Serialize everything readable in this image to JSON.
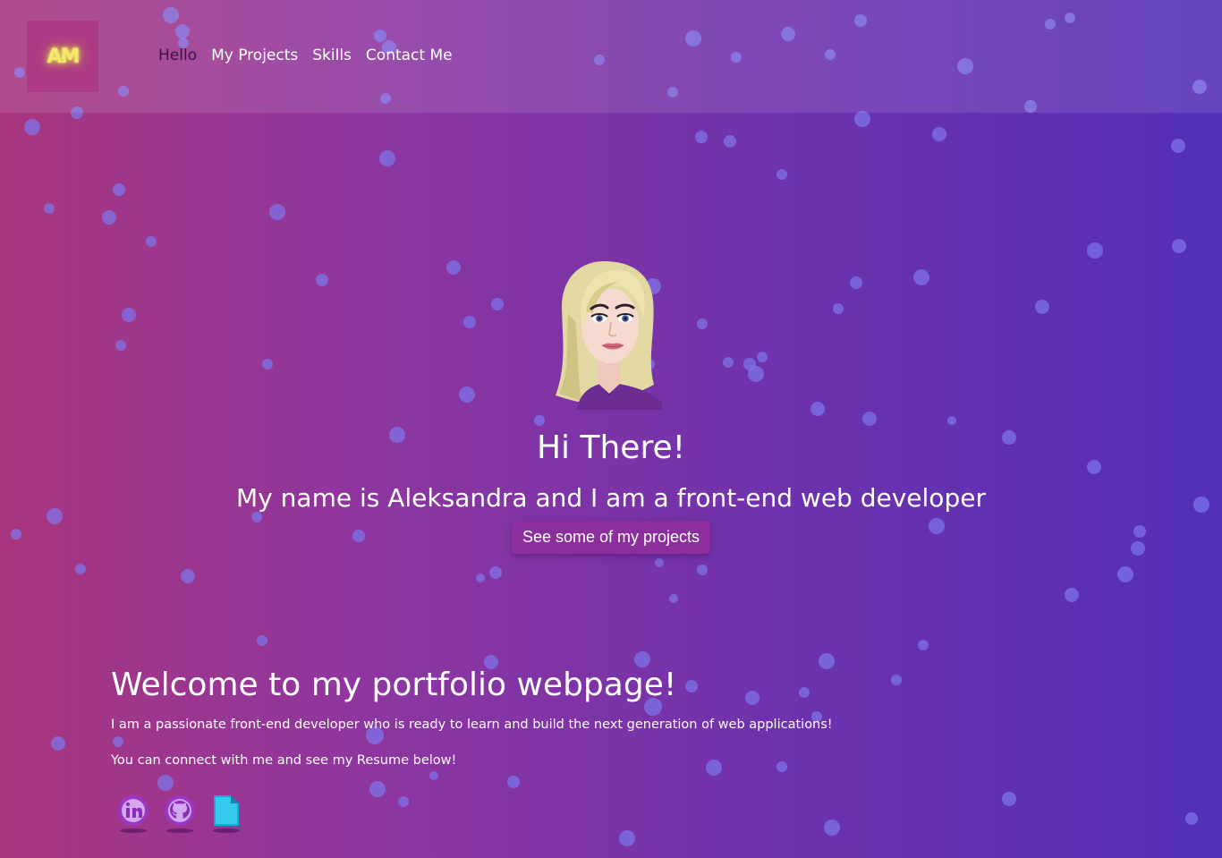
{
  "logo": {
    "text": "AM"
  },
  "nav": {
    "items": [
      {
        "label": "Hello",
        "active": true
      },
      {
        "label": "My Projects",
        "active": false
      },
      {
        "label": "Skills",
        "active": false
      },
      {
        "label": "Contact Me",
        "active": false
      }
    ]
  },
  "hero": {
    "title": "Hi There!",
    "subtitle": "My name is Aleksandra and  I am a front-end web developer",
    "cta_label": "See some of my projects"
  },
  "welcome": {
    "title": "Welcome to my portfolio webpage!",
    "paragraph1": "I am a passionate front-end developer who is ready to learn and build the next generation of web applications!",
    "paragraph2": "You can connect with me and see my  Resume below!"
  },
  "social": [
    {
      "icon": "linkedin-icon"
    },
    {
      "icon": "github-icon"
    },
    {
      "icon": "resume-icon"
    }
  ],
  "colors": {
    "gradient_left": "#a8367e",
    "gradient_right": "#542fb8",
    "bubble": "#7e76eb",
    "logo_bg": "#ae3a86",
    "cta_bg": "#8c2e9d",
    "nav_active": "#3b1040"
  }
}
